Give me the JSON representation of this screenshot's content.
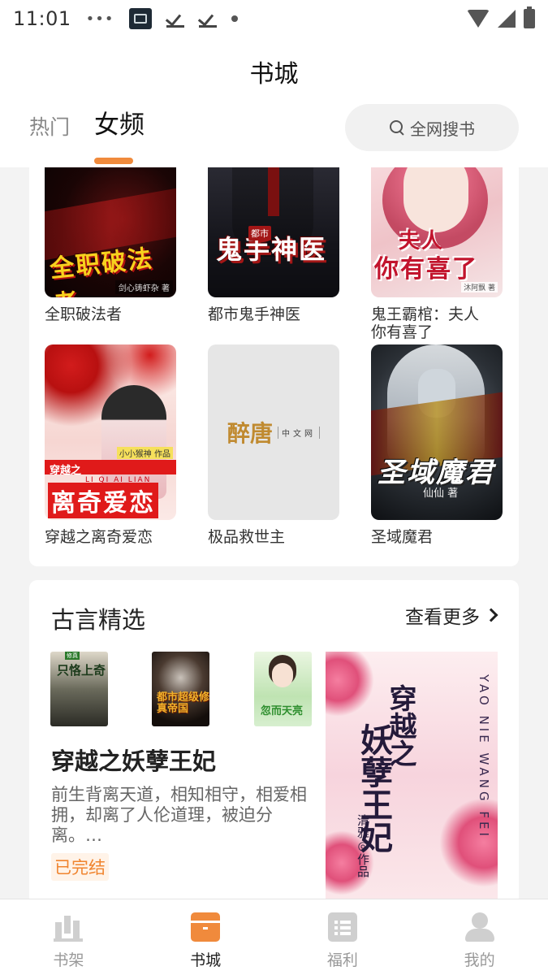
{
  "status_bar": {
    "time": "11:01",
    "icons": [
      "more-dots-icon",
      "app-notification-icon",
      "download-done-icon",
      "download-done-icon",
      "dot-icon",
      "wifi-icon",
      "signal-icon",
      "battery-icon"
    ]
  },
  "header": {
    "title": "书城",
    "tabs": [
      {
        "label": "热门",
        "active": false
      },
      {
        "label": "女频",
        "active": true
      }
    ],
    "search": {
      "label": "全网搜书",
      "icon": "search-icon"
    },
    "accent": "#f08a3c"
  },
  "book_grid": {
    "books": [
      {
        "title": "全职破法者",
        "cover_text": "全职破法者",
        "cover_sub": "剑心铸虾杂 著"
      },
      {
        "title": "都市鬼手神医",
        "cover_text": "鬼手神医",
        "cover_tag": "都市"
      },
      {
        "title": "鬼王霸棺：夫人你有喜了",
        "cover_text": "夫人",
        "cover_text2": "你有喜了",
        "cover_sub": "沐阿飘 著"
      },
      {
        "title": "穿越之离奇爱恋",
        "cover_text": "离奇爱恋",
        "cover_sub1": "穿越之",
        "cover_sub2": "LI QI AI LIAN",
        "cover_author": "小小猴神 作品"
      },
      {
        "title": "极品救世主",
        "cover_logo": "醉唐",
        "cover_logo_cn": "中文网"
      },
      {
        "title": "圣域魔君",
        "cover_text": "圣域魔君",
        "cover_author": "仙仙 著"
      }
    ]
  },
  "classic_section": {
    "title": "古言精选",
    "see_more": "查看更多",
    "thumbnails": [
      {
        "name": "thumb-1",
        "text": "只恪上奇"
      },
      {
        "name": "thumb-2",
        "text": "都市超级修真帝国"
      },
      {
        "name": "thumb-3",
        "text": "忽而天亮"
      }
    ],
    "featured": {
      "title": "穿越之妖孽王妃",
      "description": "前生背离天道，相知相守，相爱相拥，却离了人伦道理，被迫分离。…",
      "status": "已完结",
      "cover": {
        "pinyin": "YAO NIE WANG FEI",
        "title1": "穿越之",
        "title2": "妖孽王妃",
        "author": "清雅◎作品"
      }
    }
  },
  "bottom_nav": {
    "items": [
      {
        "label": "书架",
        "icon": "bookshelf-icon",
        "active": false
      },
      {
        "label": "书城",
        "icon": "bookstore-icon",
        "active": true
      },
      {
        "label": "福利",
        "icon": "welfare-icon",
        "active": false
      },
      {
        "label": "我的",
        "icon": "profile-icon",
        "active": false
      }
    ]
  }
}
